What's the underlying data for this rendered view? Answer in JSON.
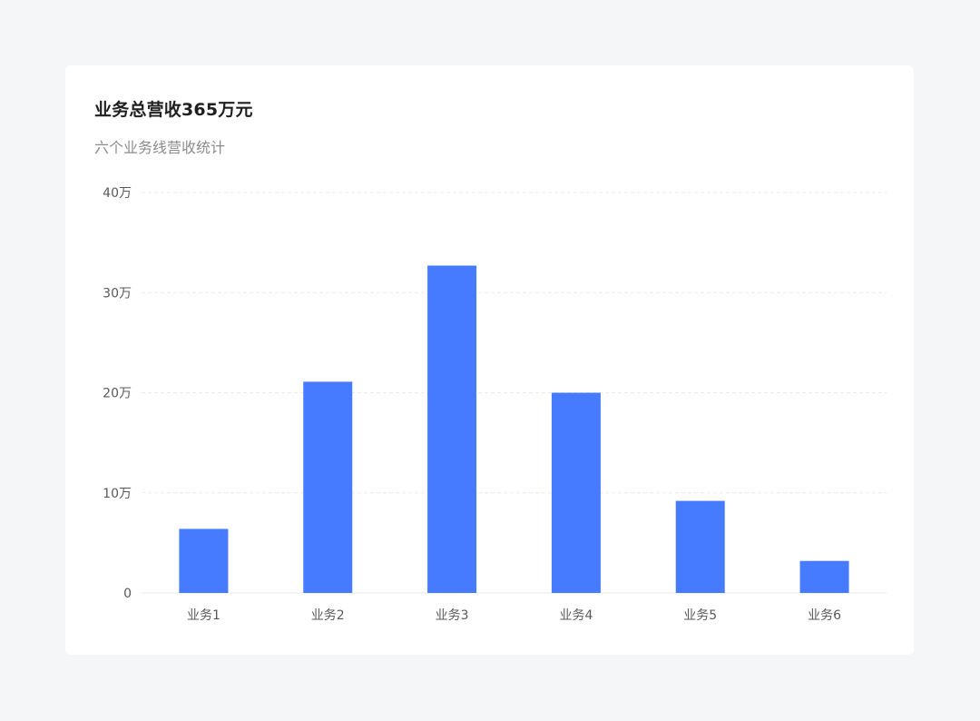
{
  "card": {
    "title": "业务总营收365万元",
    "subtitle": "六个业务线营收统计"
  },
  "chart_data": {
    "type": "bar",
    "title": "业务总营收365万元",
    "subtitle": "六个业务线营收统计",
    "categories": [
      "业务1",
      "业务2",
      "业务3",
      "业务4",
      "业务5",
      "业务6"
    ],
    "values": [
      6.4,
      21.1,
      32.7,
      20.0,
      9.2,
      3.2
    ],
    "ylim": [
      0,
      40
    ],
    "yticks": [
      0,
      10,
      20,
      30,
      40
    ],
    "ytick_labels": [
      "0",
      "10万",
      "20万",
      "30万",
      "40万"
    ],
    "grid": true,
    "color": "#477BFF"
  }
}
